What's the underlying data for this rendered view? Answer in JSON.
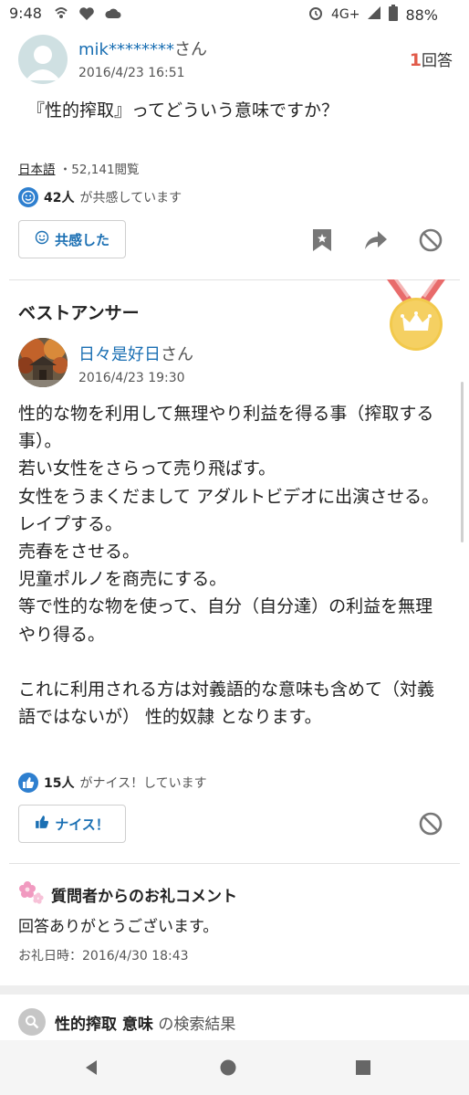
{
  "status_bar": {
    "time": "9:48",
    "network": "4G+",
    "battery": "88%"
  },
  "question": {
    "user_name": "mik********",
    "honorific": "さん",
    "date": "2016/4/23 16:51",
    "answer_count": "1",
    "answer_count_label": "回答",
    "text": "『性的搾取』ってどういう意味ですか？",
    "category": "日本語",
    "separator": "・",
    "views": "52,141閲覧",
    "empathy_count": "42人",
    "empathy_text": "が共感しています",
    "empathy_button": "共感した"
  },
  "best_answer": {
    "title": "ベストアンサー",
    "user_name": "日々是好日",
    "honorific": "さん",
    "date": "2016/4/23 19:30",
    "lines": [
      "性的な物を利用して無理やり利益を得る事（搾取する事）。",
      "若い女性をさらって売り飛ばす。",
      "女性をうまくだまして アダルトビデオに出演させる。",
      "レイプする。",
      "売春をさせる。",
      "児童ポルノを商売にする。",
      "等で性的な物を使って、自分（自分達）の利益を無理やり得る。",
      "",
      "これに利用される方は対義語的な意味も含めて（対義語ではないが） 性的奴隷 となります。"
    ],
    "nice_count": "15人",
    "nice_text": "がナイス！しています",
    "nice_button": "ナイス！"
  },
  "thanks": {
    "title": "質問者からのお礼コメント",
    "body": "回答ありがとうございます。",
    "date": "お礼日時：2016/4/30 18:43"
  },
  "search": {
    "keyword": "性的搾取 意味",
    "suffix": "の検索結果"
  },
  "colors": {
    "link_blue": "#1a6fb3",
    "accent_red": "#e15b4a",
    "medal_gold": "#f2c94c",
    "ribbon_red": "#e86b6b"
  },
  "icons": [
    "bookmark-icon",
    "share-icon",
    "block-icon",
    "smile-icon",
    "thumbs-up-icon",
    "flower-icon",
    "search-icon",
    "back-icon",
    "home-icon",
    "recents-icon"
  ]
}
